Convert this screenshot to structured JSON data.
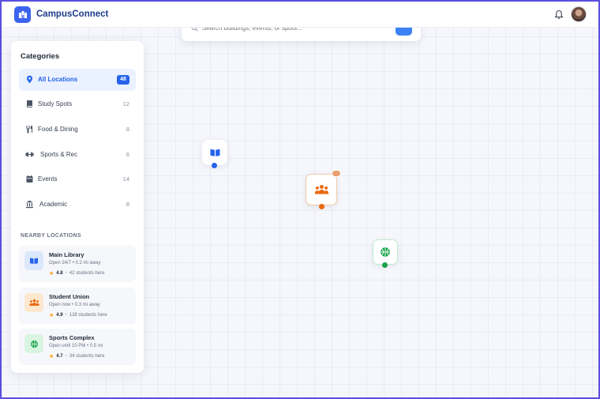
{
  "app": {
    "title": "CampusConnect"
  },
  "search": {
    "placeholder": "Search buildings, events, or spots..."
  },
  "categories": {
    "title": "Categories",
    "items": [
      {
        "label": "All Locations",
        "count": "48",
        "icon": "map-pin-icon"
      },
      {
        "label": "Study Spots",
        "count": "12",
        "icon": "book-icon"
      },
      {
        "label": "Food & Dining",
        "count": "8",
        "icon": "utensils-icon"
      },
      {
        "label": "Sports & Rec",
        "count": "6",
        "icon": "dumbbell-icon"
      },
      {
        "label": "Events",
        "count": "14",
        "icon": "calendar-icon"
      },
      {
        "label": "Academic",
        "count": "8",
        "icon": "building-columns-icon"
      }
    ]
  },
  "nearby": {
    "title": "NEARBY LOCATIONS",
    "items": [
      {
        "name": "Main Library",
        "sub": "Open 24/7 • 0.2 mi away",
        "rating": "4.8",
        "students": "42 students here",
        "icon": "book-open-icon",
        "color": "#2563eb",
        "bg": "#dbe7fb"
      },
      {
        "name": "Student Union",
        "sub": "Open now • 0.3 mi away",
        "rating": "4.9",
        "students": "128 students here",
        "icon": "users-icon",
        "color": "#ea6a12",
        "bg": "#fde8cf"
      },
      {
        "name": "Sports Complex",
        "sub": "Open until 10 PM • 0.5 mi",
        "rating": "4.7",
        "students": "34 students here",
        "icon": "basketball-icon",
        "color": "#16a34a",
        "bg": "#d9f5e2"
      }
    ]
  },
  "map_markers": [
    {
      "name": "library-marker",
      "icon": "book-open-icon",
      "color": "#2563eb"
    },
    {
      "name": "student-union-marker",
      "icon": "users-icon",
      "color": "#ea6a12"
    },
    {
      "name": "sports-complex-marker",
      "icon": "basketball-icon",
      "color": "#16a34a"
    }
  ],
  "colors": {
    "primary": "#3b63f0",
    "accent_blue": "#2563eb",
    "frame": "#5b4ee0"
  }
}
